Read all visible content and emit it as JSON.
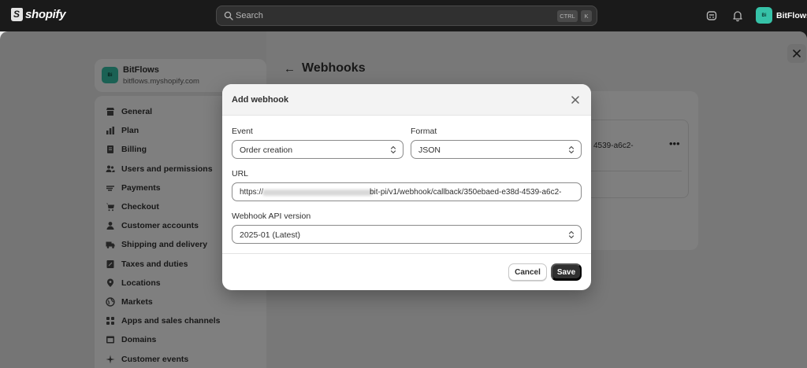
{
  "topbar": {
    "brand": "shopify",
    "search_placeholder": "Search",
    "shortcut_ctrl": "CTRL",
    "shortcut_k": "K",
    "store_initials": "Bi",
    "store_name": "BitFlows"
  },
  "sidebar": {
    "store_name": "BitFlows",
    "store_domain": "bitflows.myshopify.com",
    "store_initials": "Bi",
    "items": [
      {
        "label": "General",
        "icon": "store-icon"
      },
      {
        "label": "Plan",
        "icon": "bar-chart-icon"
      },
      {
        "label": "Billing",
        "icon": "receipt-icon"
      },
      {
        "label": "Users and permissions",
        "icon": "users-icon"
      },
      {
        "label": "Payments",
        "icon": "payments-icon"
      },
      {
        "label": "Checkout",
        "icon": "cart-icon"
      },
      {
        "label": "Customer accounts",
        "icon": "person-icon"
      },
      {
        "label": "Shipping and delivery",
        "icon": "truck-icon"
      },
      {
        "label": "Taxes and duties",
        "icon": "tax-icon"
      },
      {
        "label": "Locations",
        "icon": "location-pin-icon"
      },
      {
        "label": "Markets",
        "icon": "globe-icon"
      },
      {
        "label": "Apps and sales channels",
        "icon": "apps-icon"
      },
      {
        "label": "Domains",
        "icon": "domain-icon"
      },
      {
        "label": "Customer events",
        "icon": "sparkle-icon"
      }
    ]
  },
  "main": {
    "title": "Webhooks",
    "url_fragment": "4539-a6c2-"
  },
  "modal": {
    "title": "Add webhook",
    "event_label": "Event",
    "event_value": "Order creation",
    "format_label": "Format",
    "format_value": "JSON",
    "url_label": "URL",
    "url_prefix": "https://",
    "url_suffix": "bit-pi/v1/webhook/callback/350ebaed-e38d-4539-a6c2-",
    "api_version_label": "Webhook API version",
    "api_version_value": "2025-01 (Latest)",
    "cancel_label": "Cancel",
    "save_label": "Save"
  }
}
